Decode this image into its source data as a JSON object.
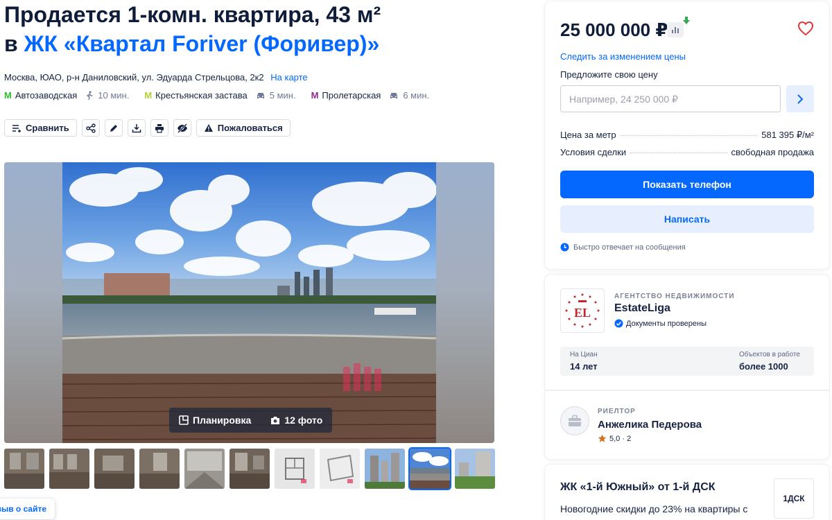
{
  "listing": {
    "title_line1": "Продается 1-комн. квартира, 43 м²",
    "title_prefix": "в",
    "title_jk": "ЖК «Квартал Foriver (Форивер)»",
    "address": "Москва, ЮАО, р-н Даниловский, ул. Эдуарда Стрельцова, 2к2",
    "map_link": "На карте"
  },
  "metro": [
    {
      "name": "Автозаводская",
      "time": "10 мин.",
      "mode": "walk",
      "color": "#2dbe2c"
    },
    {
      "name": "Крестьянская застава",
      "time": "5 мин.",
      "mode": "car",
      "color": "#b1d332"
    },
    {
      "name": "Пролетарская",
      "time": "6 мин.",
      "mode": "car",
      "color": "#8d2b8d"
    }
  ],
  "actions": {
    "compare": "Сравнить",
    "report": "Пожаловаться",
    "icons": [
      "share-icon",
      "edit-icon",
      "download-icon",
      "print-icon",
      "hide-icon"
    ]
  },
  "gallery": {
    "plan_label": "Планировка",
    "photos_label": "12 фото",
    "thumbs_count": 11,
    "active_thumb": 9
  },
  "feedback": "зыв о сайте",
  "price_card": {
    "price": "25 000 000 ₽",
    "follow": "Следить за изменением цены",
    "offer_label": "Предложите свою цену",
    "offer_placeholder": "Например, 24 250 000 ₽",
    "price_per_m_label": "Цена за метр",
    "price_per_m": "581 395 ₽/м²",
    "deal_label": "Условия сделки",
    "deal": "свободная продажа",
    "show_phone": "Показать телефон",
    "write": "Написать",
    "fast_reply": "Быстро отвечает на сообщения"
  },
  "agency": {
    "type": "АГЕНТСТВО НЕДВИЖИМОСТИ",
    "name": "EstateLiga",
    "verified": "Документы проверены",
    "on_cian_label": "На Циан",
    "on_cian": "14 лет",
    "objects_label": "Объектов в работе",
    "objects": "более 1000",
    "logo_text": "EL"
  },
  "realtor": {
    "type": "РИЕЛТОР",
    "name": "Анжелика Педерова",
    "rating": "5,0",
    "reviews": "· 2"
  },
  "promo": {
    "title": "ЖК «1-й Южный» от 1-й ДСК",
    "text": "Новогодние скидки до 23% на квартиры с",
    "logo_text": "1ДСК"
  },
  "colors": {
    "accent": "#0468ff",
    "heart": "#e2353a"
  }
}
